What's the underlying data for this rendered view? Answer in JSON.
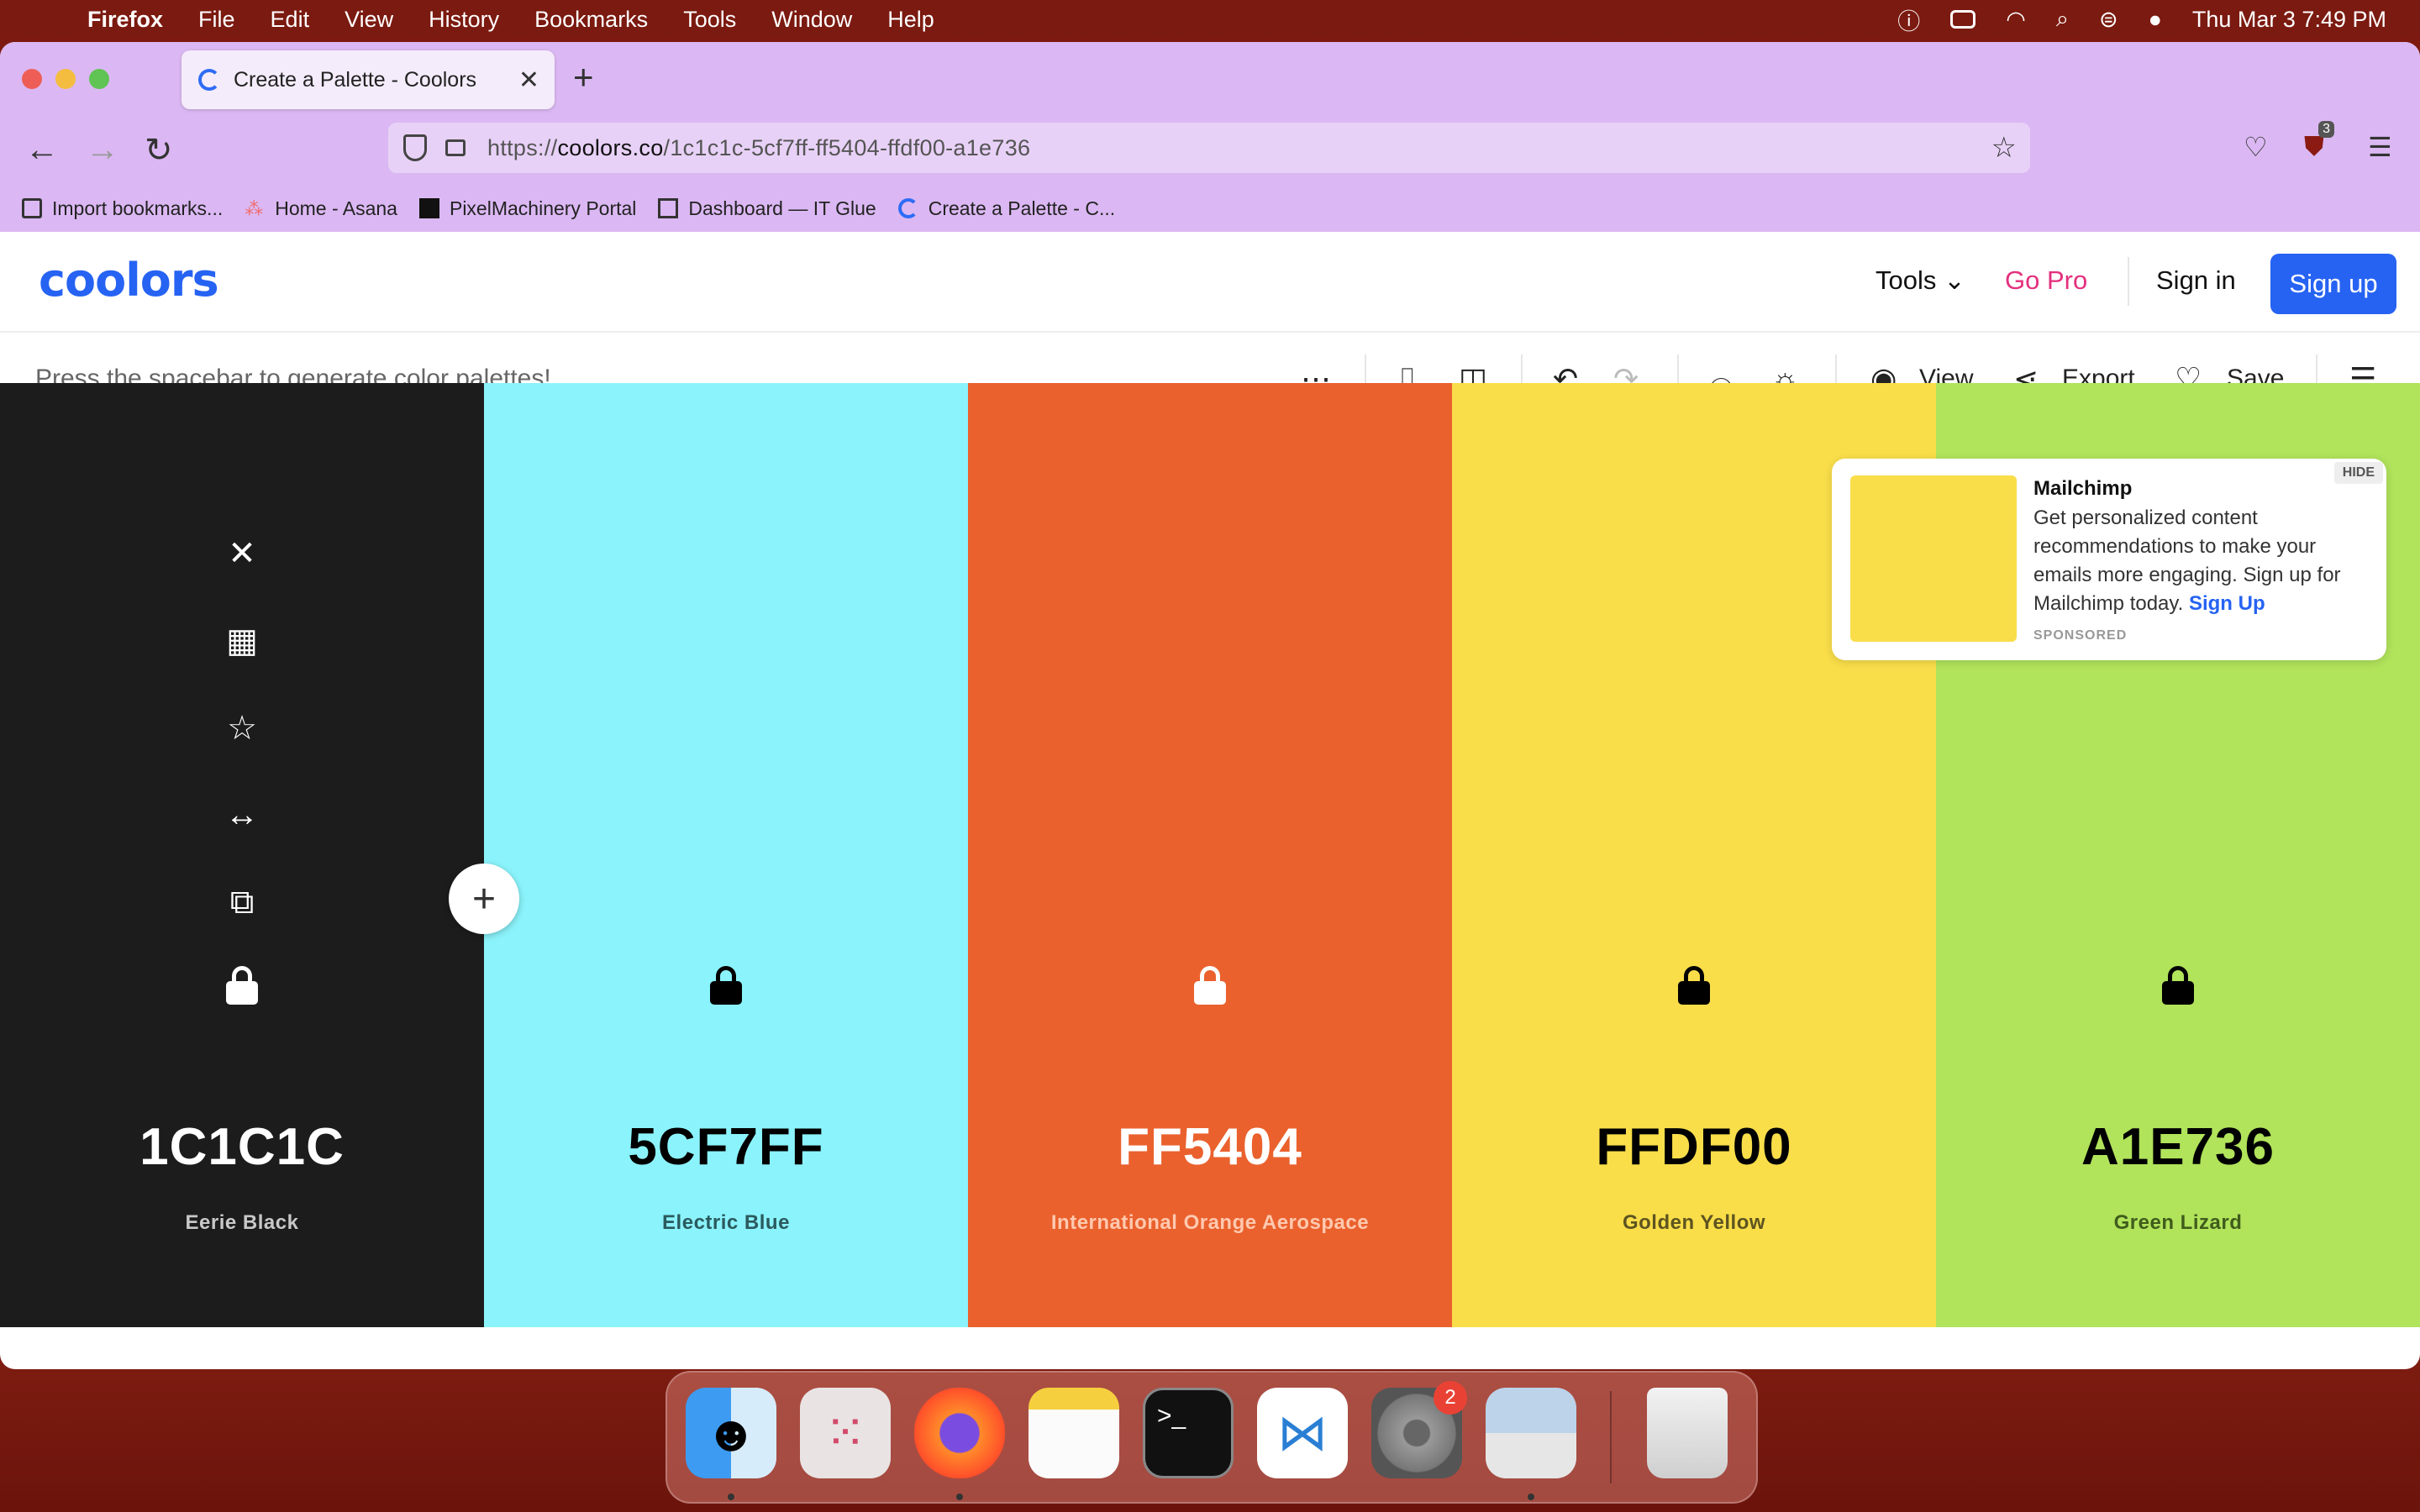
{
  "menubar": {
    "app": "Firefox",
    "items": [
      "File",
      "Edit",
      "View",
      "History",
      "Bookmarks",
      "Tools",
      "Window",
      "Help"
    ],
    "datetime": "Thu Mar 3  7:49 PM"
  },
  "browser": {
    "tab_title": "Create a Palette - Coolors",
    "url_prefix": "https://",
    "url_domain": "coolors.co",
    "url_path": "/1c1c1c-5cf7ff-ff5404-ffdf00-a1e736",
    "extension_badge": "3",
    "bookmarks": [
      "Import bookmarks...",
      "Home - Asana",
      "PixelMachinery Portal",
      "Dashboard — IT Glue",
      "Create a Palette - C..."
    ]
  },
  "header": {
    "logo": "coolors",
    "tools": "Tools",
    "go_pro": "Go Pro",
    "sign_in": "Sign in",
    "sign_up": "Sign up"
  },
  "toolbar": {
    "hint": "Press the spacebar to generate color palettes!",
    "view": "View",
    "export": "Export",
    "save": "Save"
  },
  "palette": [
    {
      "hex": "1C1C1C",
      "name": "Eerie Black",
      "bg": "#1c1c1c",
      "fg": "#ffffff",
      "sub": "#c8c8c8"
    },
    {
      "hex": "5CF7FF",
      "name": "Electric Blue",
      "bg": "#8bf3fb",
      "fg": "#000000",
      "sub": "#2a5a5e"
    },
    {
      "hex": "FF5404",
      "name": "International Orange Aerospace",
      "bg": "#ea612d",
      "fg": "#ffffff",
      "sub": "#ffc9b0"
    },
    {
      "hex": "FFDF00",
      "name": "Golden Yellow",
      "bg": "#f9de4a",
      "fg": "#000000",
      "sub": "#5e5420"
    },
    {
      "hex": "A1E736",
      "name": "Green Lizard",
      "bg": "#b1e35b",
      "fg": "#000000",
      "sub": "#3f5c1c"
    }
  ],
  "ad": {
    "title": "Mailchimp",
    "body": "Get personalized content recommendations to make your emails more engaging. Sign up for Mailchimp today.",
    "cta": "Sign Up",
    "sponsored": "SPONSORED",
    "hide": "HIDE"
  },
  "dock": {
    "apps": [
      "finder",
      "launchpad",
      "firefox",
      "notes",
      "terminal",
      "vscode",
      "system-preferences",
      "preview",
      "trash"
    ],
    "system_preferences_badge": "2"
  }
}
